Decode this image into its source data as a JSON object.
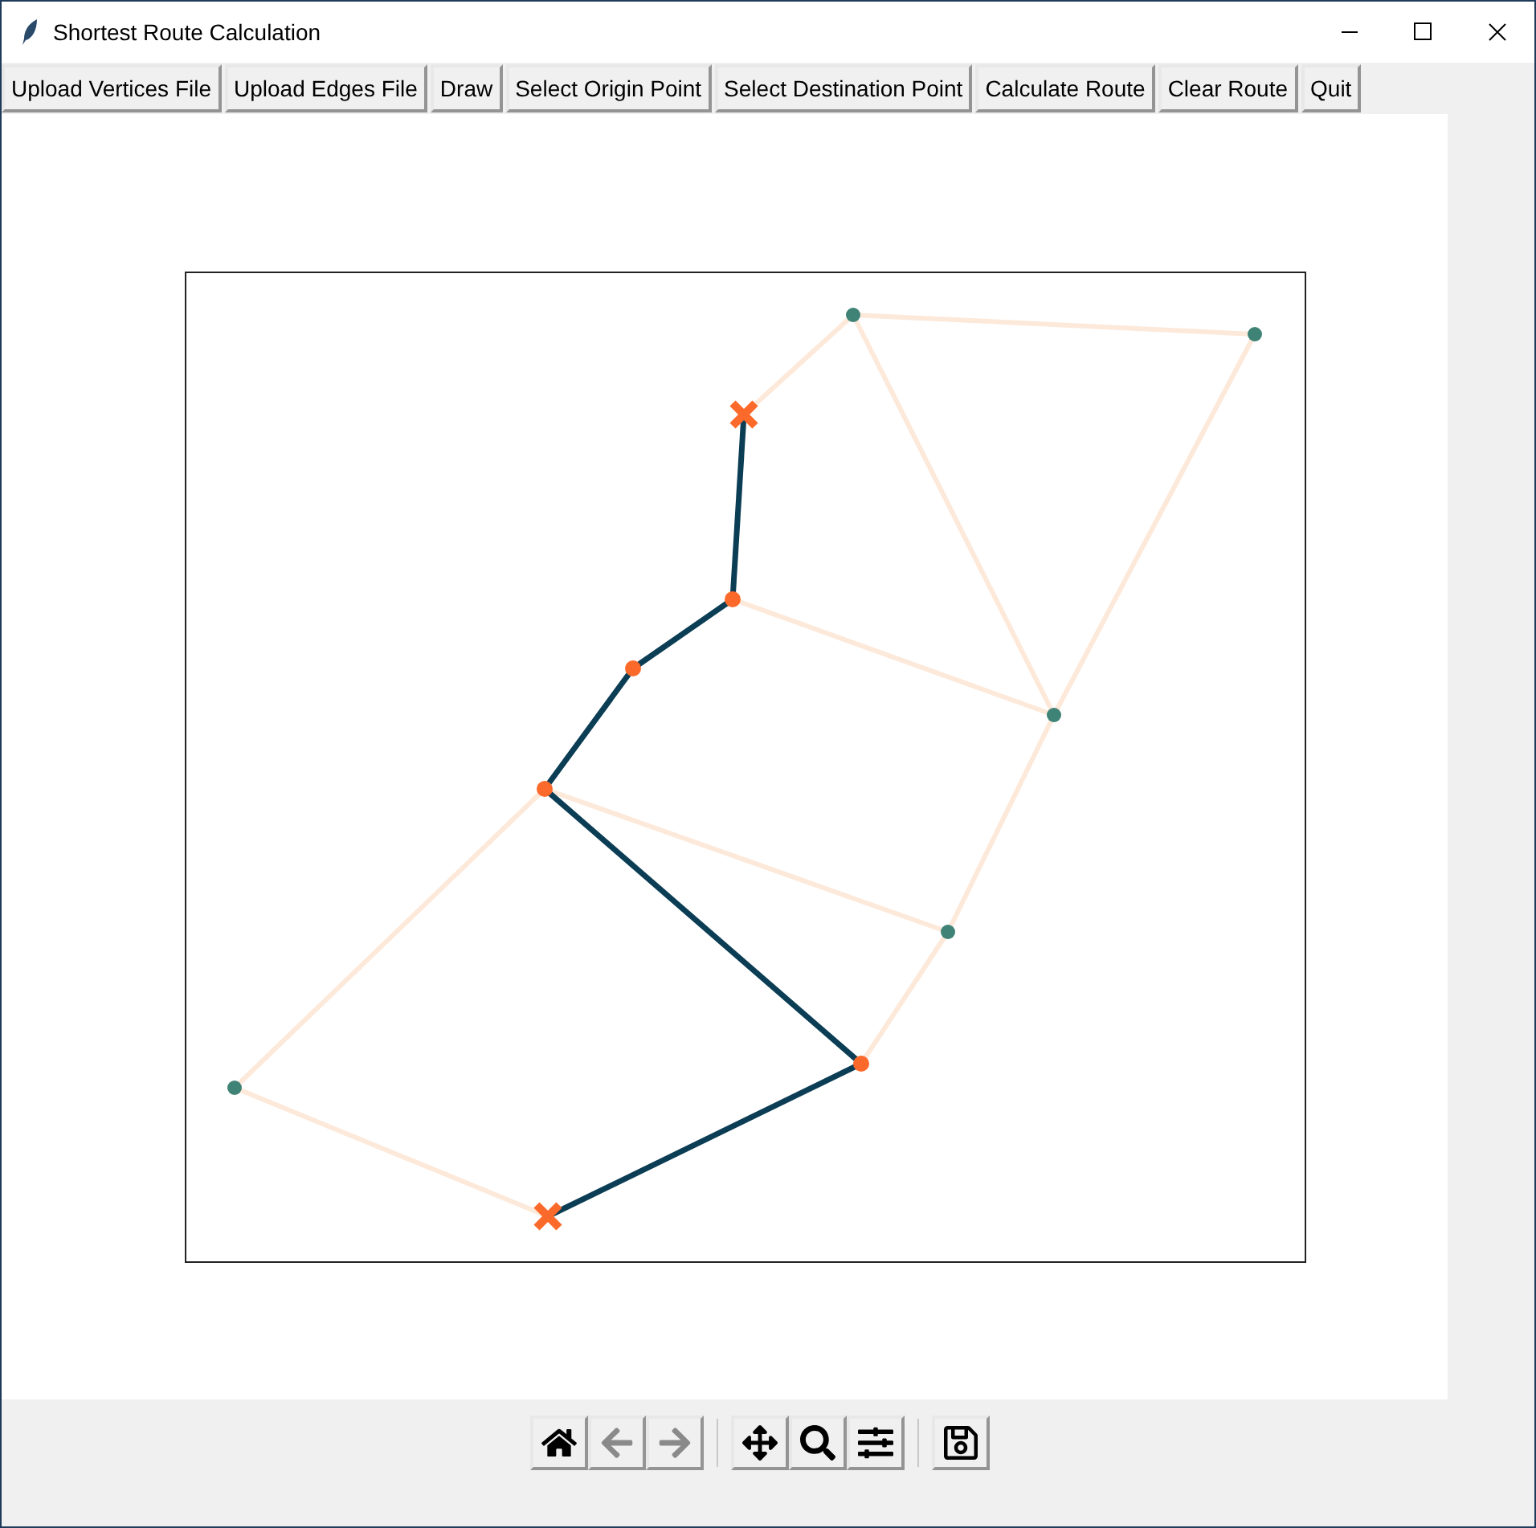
{
  "window": {
    "title": "Shortest Route Calculation"
  },
  "buttons": [
    "Upload Vertices File",
    "Upload Edges File",
    "Draw",
    "Select Origin Point",
    "Select Destination Point",
    "Calculate Route",
    "Clear Route",
    "Quit"
  ],
  "toolbar": [
    {
      "kind": "home",
      "disabled": false
    },
    {
      "kind": "back",
      "disabled": true
    },
    {
      "kind": "forward",
      "disabled": true
    },
    {
      "kind": "separator"
    },
    {
      "kind": "pan",
      "disabled": false
    },
    {
      "kind": "zoom",
      "disabled": false
    },
    {
      "kind": "configure",
      "disabled": false
    },
    {
      "kind": "separator"
    },
    {
      "kind": "save",
      "disabled": false
    }
  ]
}
